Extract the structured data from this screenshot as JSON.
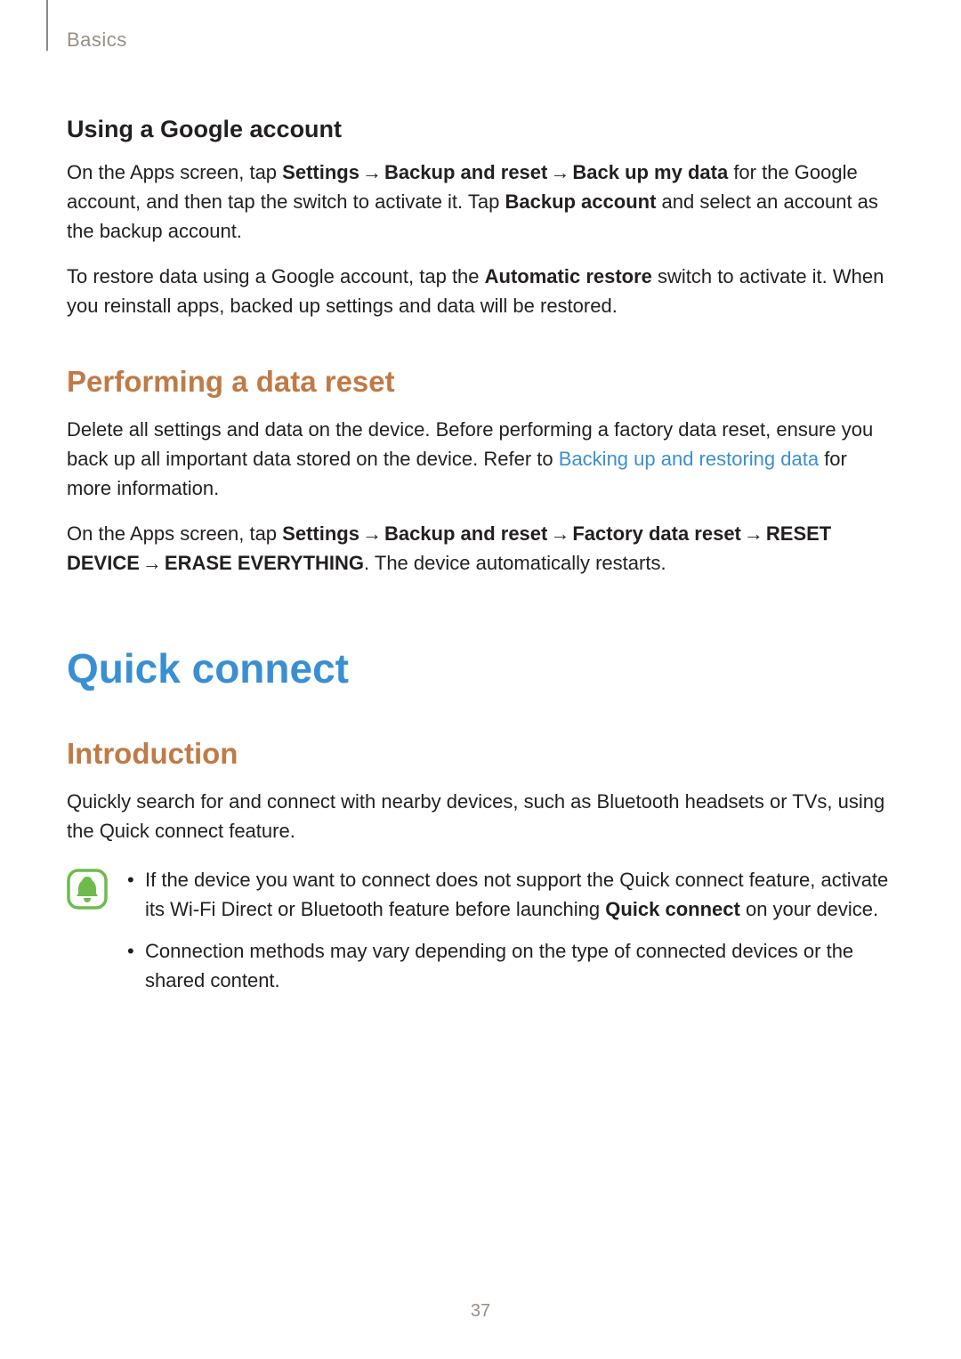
{
  "breadcrumb": "Basics",
  "section1": {
    "heading": "Using a Google account",
    "para1": {
      "t1": "On the Apps screen, tap ",
      "b1": "Settings",
      "a1": " → ",
      "b2": "Backup and reset",
      "a2": " → ",
      "b3": "Back up my data",
      "t2": " for the Google account, and then tap the switch to activate it. Tap ",
      "b4": "Backup account",
      "t3": " and select an account as the backup account."
    },
    "para2": {
      "t1": "To restore data using a Google account, tap the ",
      "b1": "Automatic restore",
      "t2": " switch to activate it. When you reinstall apps, backed up settings and data will be restored."
    }
  },
  "section2": {
    "heading": "Performing a data reset",
    "para1": {
      "t1": "Delete all settings and data on the device. Before performing a factory data reset, ensure you back up all important data stored on the device. Refer to ",
      "link": "Backing up and restoring data",
      "t2": " for more information."
    },
    "para2": {
      "t1": "On the Apps screen, tap ",
      "b1": "Settings",
      "a1": " → ",
      "b2": "Backup and reset",
      "a2": " → ",
      "b3": "Factory data reset",
      "a3": " → ",
      "b4": "RESET DEVICE",
      "a4": " → ",
      "b5": "ERASE EVERYTHING",
      "t2": ". The device automatically restarts."
    }
  },
  "section3": {
    "title": "Quick connect",
    "heading": "Introduction",
    "para1": "Quickly search for and connect with nearby devices, such as Bluetooth headsets or TVs, using the Quick connect feature.",
    "bullets": [
      {
        "t1": "If the device you want to connect does not support the Quick connect feature, activate its Wi-Fi Direct or Bluetooth feature before launching ",
        "b1": "Quick connect",
        "t2": " on your device."
      },
      {
        "t1": "Connection methods may vary depending on the type of connected devices or the shared content.",
        "b1": "",
        "t2": ""
      }
    ]
  },
  "pageNumber": "37"
}
